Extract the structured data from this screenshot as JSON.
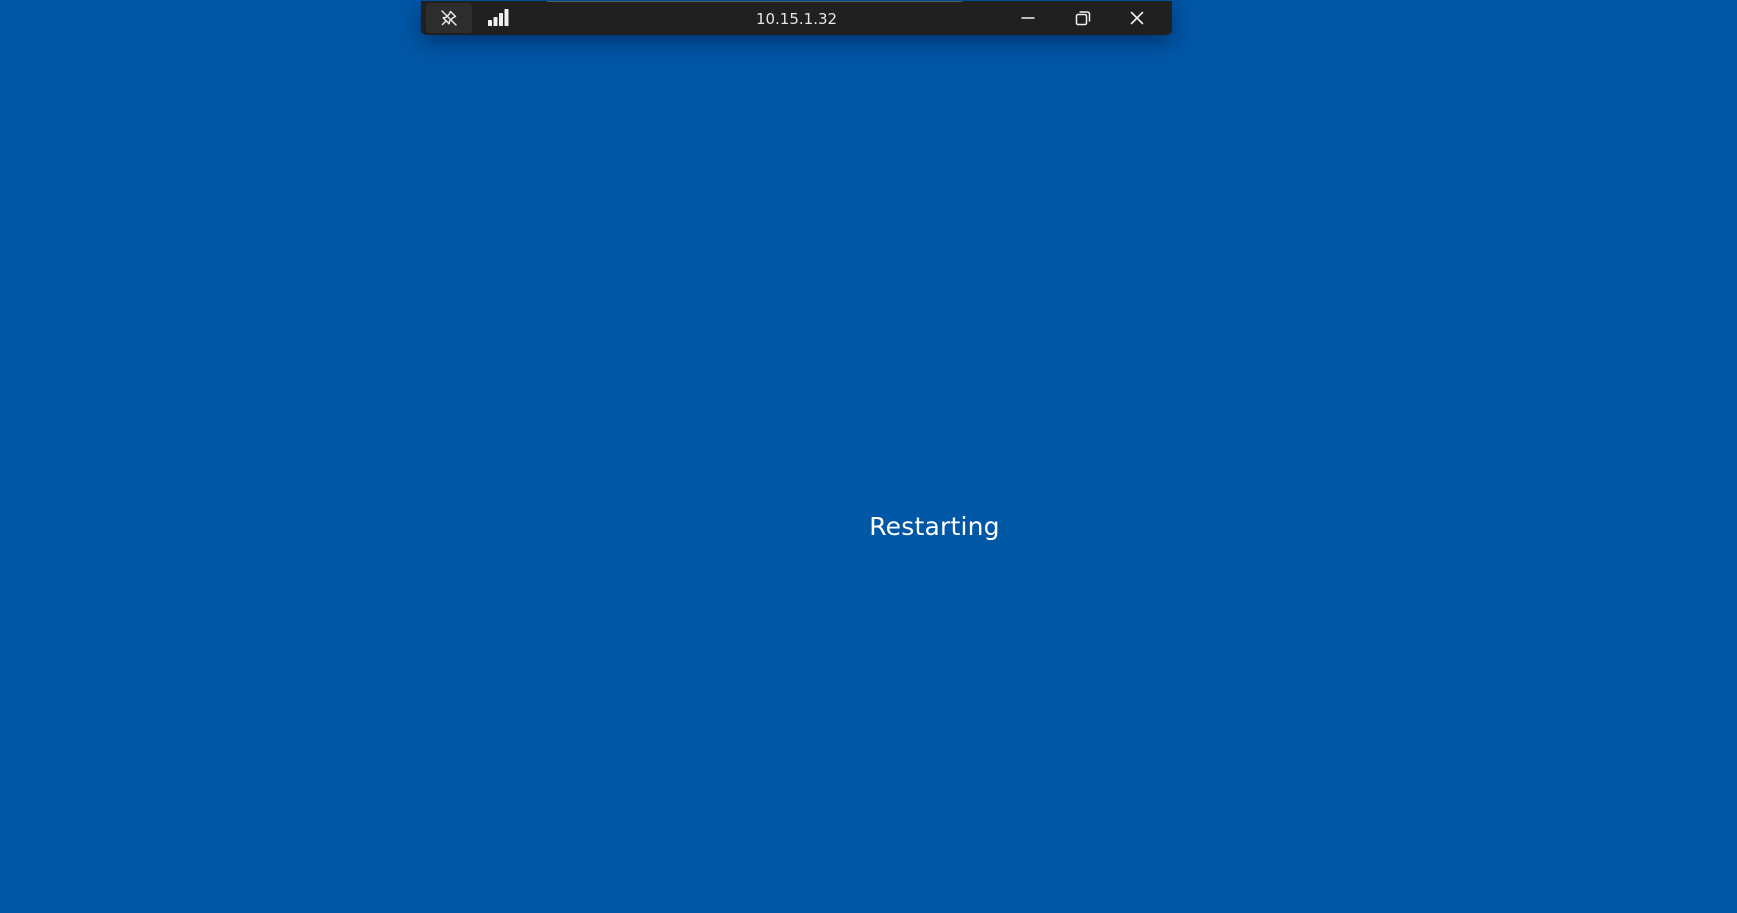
{
  "connection_bar": {
    "title": "10.15.1.32",
    "icons": {
      "pin": "pin-off-icon",
      "signal": "signal-strength-icon",
      "minimize": "minimize-icon",
      "restore": "restore-icon",
      "close": "close-icon"
    }
  },
  "screen": {
    "status": "Restarting"
  },
  "colors": {
    "background": "#0057a6",
    "bar": "#202020",
    "text": "#ffffff"
  }
}
